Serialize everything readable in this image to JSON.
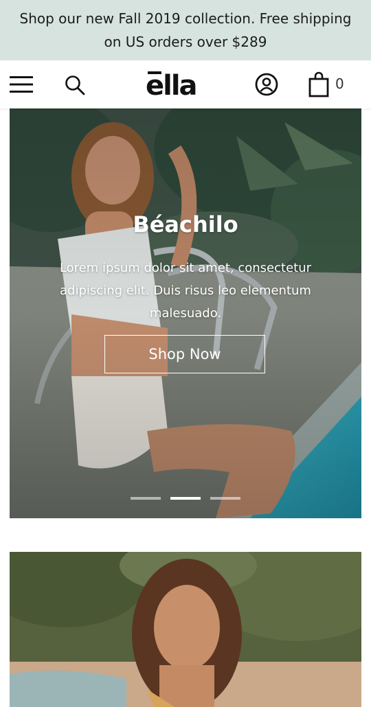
{
  "announcement": {
    "text": "Shop our new Fall 2019 collection. Free shipping on US orders over $289"
  },
  "header": {
    "logo_text": "ella",
    "cart_count": "0",
    "icons": [
      "menu-icon",
      "search-icon",
      "account-icon",
      "cart-icon"
    ]
  },
  "hero": {
    "title": "Béachilo",
    "description": "Lorem ipsum dolor sit amet, consectetur adipiscing elit. Duis risus leo elementum malesuado.",
    "button_label": "Shop Now",
    "slides_total": 3,
    "active_slide": 2
  },
  "colors": {
    "announcement_bg": "#d6e3df",
    "text_dark": "#111111",
    "hero_text": "#ffffff"
  }
}
